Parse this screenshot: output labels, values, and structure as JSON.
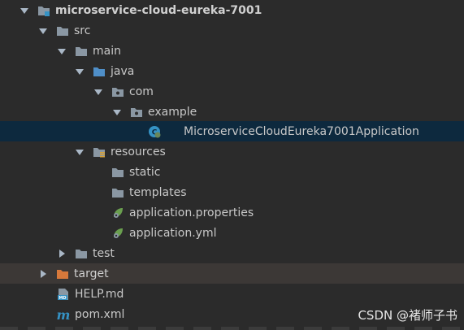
{
  "colors": {
    "background": "#2b2b2b",
    "selected_row": "#0d293e",
    "excluded_row": "#3c3836",
    "folder": "#8a97a3",
    "source_folder": "#4f8fc8",
    "target_folder": "#d7793b"
  },
  "tree": {
    "project": {
      "label": "microservice-cloud-eureka-7001",
      "icon": "module-folder-icon"
    },
    "src": {
      "label": "src",
      "icon": "folder-icon"
    },
    "main": {
      "label": "main",
      "icon": "folder-icon"
    },
    "java": {
      "label": "java",
      "icon": "source-folder-icon"
    },
    "com": {
      "label": "com",
      "icon": "package-icon"
    },
    "example": {
      "label": "example",
      "icon": "package-icon"
    },
    "app_class": {
      "label": "MicroserviceCloudEureka7001Application",
      "icon": "spring-boot-class-icon"
    },
    "resources": {
      "label": "resources",
      "icon": "resources-folder-icon"
    },
    "static": {
      "label": "static",
      "icon": "folder-icon"
    },
    "templates": {
      "label": "templates",
      "icon": "folder-icon"
    },
    "app_properties": {
      "label": "application.properties",
      "icon": "spring-config-icon"
    },
    "app_yml": {
      "label": "application.yml",
      "icon": "spring-config-icon"
    },
    "test": {
      "label": "test",
      "icon": "folder-icon"
    },
    "target": {
      "label": "target",
      "icon": "excluded-folder-icon"
    },
    "help_md": {
      "label": "HELP.md",
      "icon": "markdown-file-icon"
    },
    "pom_xml": {
      "label": "pom.xml",
      "icon": "maven-file-icon"
    }
  },
  "watermark": "CSDN @褚师子书"
}
